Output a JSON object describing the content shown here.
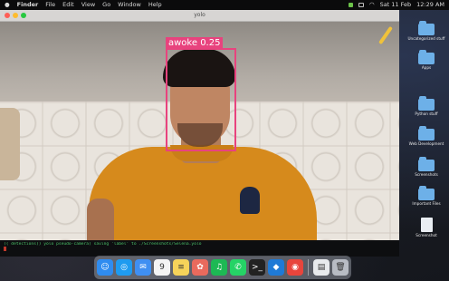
{
  "menubar": {
    "app_name": "Finder",
    "items": [
      "File",
      "Edit",
      "View",
      "Go",
      "Window",
      "Help"
    ],
    "right_items": [
      "Sat 11 Feb",
      "12:29 AM"
    ]
  },
  "camera_window": {
    "title": "yolo",
    "detection_label": "awoke 0.25"
  },
  "terminal": {
    "line": "(( detections)) yolo pseudo-camera)    saving 'label' to ./Screenshots/Selena.yolo"
  },
  "desktop_icons": [
    {
      "label": "Uncategorized stuff",
      "kind": "folder"
    },
    {
      "label": "Apps",
      "kind": "folder"
    },
    {
      "label": "Python stuff",
      "kind": "folder"
    },
    {
      "label": "Web Development",
      "kind": "folder"
    },
    {
      "label": "Screenshots",
      "kind": "folder"
    },
    {
      "label": "Important Files",
      "kind": "folder"
    },
    {
      "label": "Screenshot",
      "kind": "file"
    }
  ],
  "dock": {
    "apps": [
      {
        "icon": "finder-icon",
        "glyph": "☺",
        "color": "#2f8cf0"
      },
      {
        "icon": "safari-icon",
        "glyph": "◎",
        "color": "#1e9bf0"
      },
      {
        "icon": "mail-icon",
        "glyph": "✉",
        "color": "#3f8ff2"
      },
      {
        "icon": "calendar-icon",
        "glyph": "9",
        "color": "#f4f4f4"
      },
      {
        "icon": "notes-icon",
        "glyph": "≡",
        "color": "#f6d35a"
      },
      {
        "icon": "photos-icon",
        "glyph": "✿",
        "color": "#e96a5d"
      },
      {
        "icon": "spotify-icon",
        "glyph": "♫",
        "color": "#1db954"
      },
      {
        "icon": "whatsapp-icon",
        "glyph": "✆",
        "color": "#25d366"
      },
      {
        "icon": "terminal-icon",
        "glyph": ">_",
        "color": "#222222"
      },
      {
        "icon": "vscode-icon",
        "glyph": "◆",
        "color": "#1f7ad6"
      },
      {
        "icon": "chrome-icon",
        "glyph": "◉",
        "color": "#e8453c"
      },
      {
        "icon": "document-icon",
        "glyph": "▤",
        "color": "#e8eaed"
      },
      {
        "icon": "trash-icon",
        "glyph": "🗑",
        "color": "#b8bcc4"
      }
    ]
  },
  "colors": {
    "detection_box": "#e8437e",
    "shirt": "#d68a1c",
    "terminal_text": "#4cc46a"
  }
}
